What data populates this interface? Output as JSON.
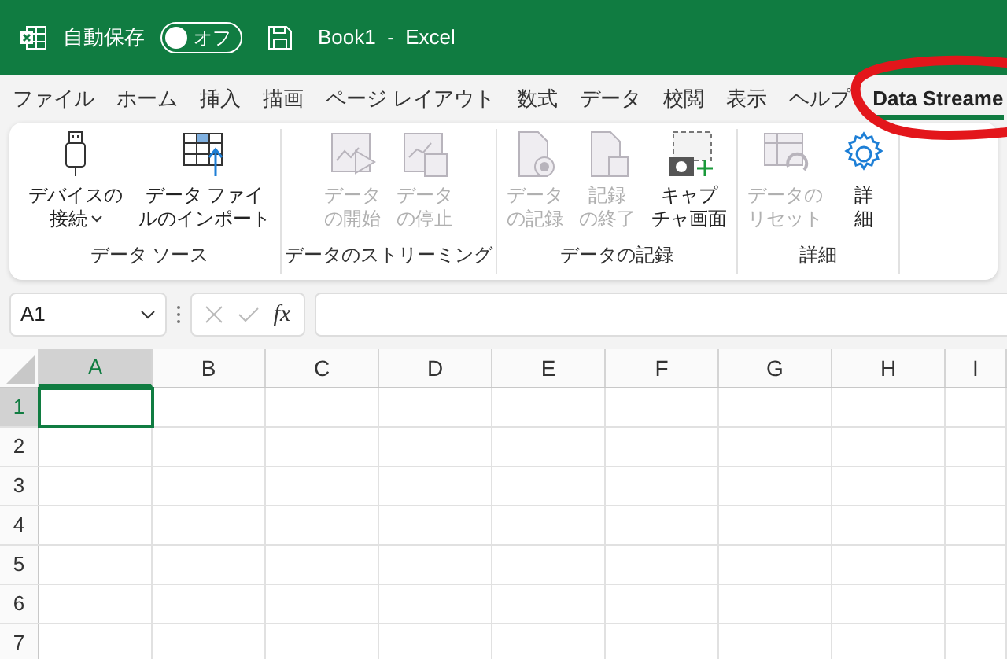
{
  "title_bar": {
    "autosave": {
      "label": "自動保存",
      "on": false,
      "state_text": "オフ"
    },
    "title": "Book1  -  Excel"
  },
  "menu_tabs": [
    {
      "label": "ファイル",
      "selected": false
    },
    {
      "label": "ホーム",
      "selected": false
    },
    {
      "label": "挿入",
      "selected": false
    },
    {
      "label": "描画",
      "selected": false
    },
    {
      "label": "ページ レイアウト",
      "selected": false
    },
    {
      "label": "数式",
      "selected": false
    },
    {
      "label": "データ",
      "selected": false
    },
    {
      "label": "校閲",
      "selected": false
    },
    {
      "label": "表示",
      "selected": false
    },
    {
      "label": "ヘルプ",
      "selected": false
    },
    {
      "label": "Data Streame",
      "selected": true
    }
  ],
  "ribbon_groups": [
    {
      "label": "データ ソース",
      "buttons": [
        {
          "lines": [
            "デバイスの",
            "接続"
          ],
          "disabled": false,
          "dropdown": true
        },
        {
          "lines": [
            "データ ファイ",
            "ルのインポート"
          ],
          "disabled": false,
          "dropdown": false
        }
      ]
    },
    {
      "label": "データのストリーミング",
      "buttons": [
        {
          "lines": [
            "データ",
            "の開始"
          ],
          "disabled": true,
          "dropdown": false
        },
        {
          "lines": [
            "データ",
            "の停止"
          ],
          "disabled": true,
          "dropdown": false
        }
      ]
    },
    {
      "label": "データの記録",
      "buttons": [
        {
          "lines": [
            "データ",
            "の記録"
          ],
          "disabled": true,
          "dropdown": false
        },
        {
          "lines": [
            "記録",
            "の終了"
          ],
          "disabled": true,
          "dropdown": false
        },
        {
          "lines": [
            "キャプ",
            "チャ画面"
          ],
          "disabled": false,
          "dropdown": false
        }
      ]
    },
    {
      "label": "詳細",
      "buttons": [
        {
          "lines": [
            "データの",
            "リセット"
          ],
          "disabled": true,
          "dropdown": false
        },
        {
          "lines": [
            "詳",
            "細"
          ],
          "disabled": false,
          "dropdown": false
        }
      ]
    }
  ],
  "formula_bar": {
    "name_box": "A1",
    "fx": "fx"
  },
  "sheet": {
    "columns": [
      {
        "label": "A",
        "selected": true
      },
      {
        "label": "B",
        "selected": false
      },
      {
        "label": "C",
        "selected": false
      },
      {
        "label": "D",
        "selected": false
      },
      {
        "label": "E",
        "selected": false
      },
      {
        "label": "F",
        "selected": false
      },
      {
        "label": "G",
        "selected": false
      },
      {
        "label": "H",
        "selected": false
      },
      {
        "label": "I",
        "selected": false
      }
    ],
    "rows": [
      {
        "label": "1",
        "selected": true
      },
      {
        "label": "2",
        "selected": false
      },
      {
        "label": "3",
        "selected": false
      },
      {
        "label": "4",
        "selected": false
      },
      {
        "label": "5",
        "selected": false
      },
      {
        "label": "6",
        "selected": false
      },
      {
        "label": "7",
        "selected": false
      }
    ]
  }
}
